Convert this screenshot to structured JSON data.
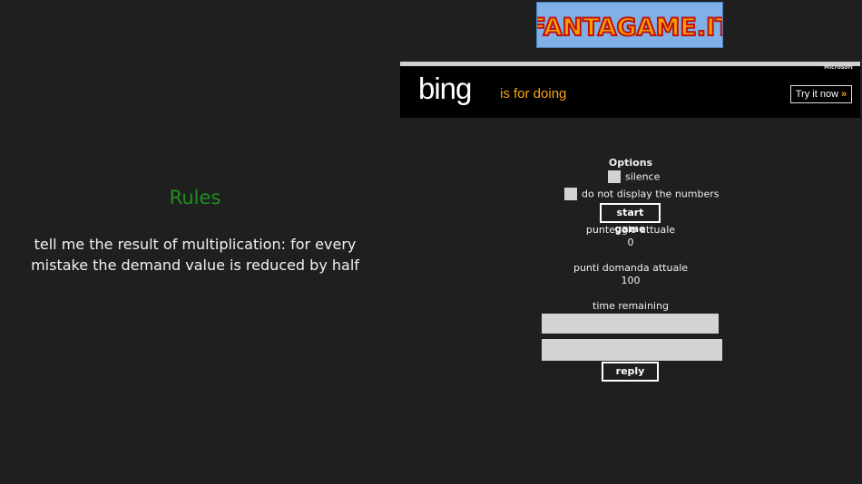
{
  "rules": {
    "title": "Rules",
    "text": "tell me the result of multiplication: for every mistake the demand value is reduced by half"
  },
  "logo": {
    "text": "FANTAGAME.IT",
    "colors": {
      "background": "#7fb0e6",
      "letter_fill": "#f5a000",
      "letter_outline": "#c01010"
    }
  },
  "ad": {
    "brand": "bing",
    "tagline": "is for doing",
    "small_text": "Microsoft",
    "button_label": "Try it now",
    "button_arrow": "»",
    "colors": {
      "accent": "#f7a21b"
    }
  },
  "options": {
    "title": "Options",
    "silence_label": "silence",
    "hide_numbers_label": "do not display the numbers",
    "start_button": "start game",
    "current_score_label": "punteggio attuale",
    "current_score_value": "0",
    "question_points_label": "punti domanda attuale",
    "question_points_value": "100",
    "time_label": "time remaining",
    "reply_button": "reply"
  },
  "colors": {
    "background": "#1f1f1f",
    "rules_title": "#1e8f1e",
    "field": "#d4d4d4"
  }
}
